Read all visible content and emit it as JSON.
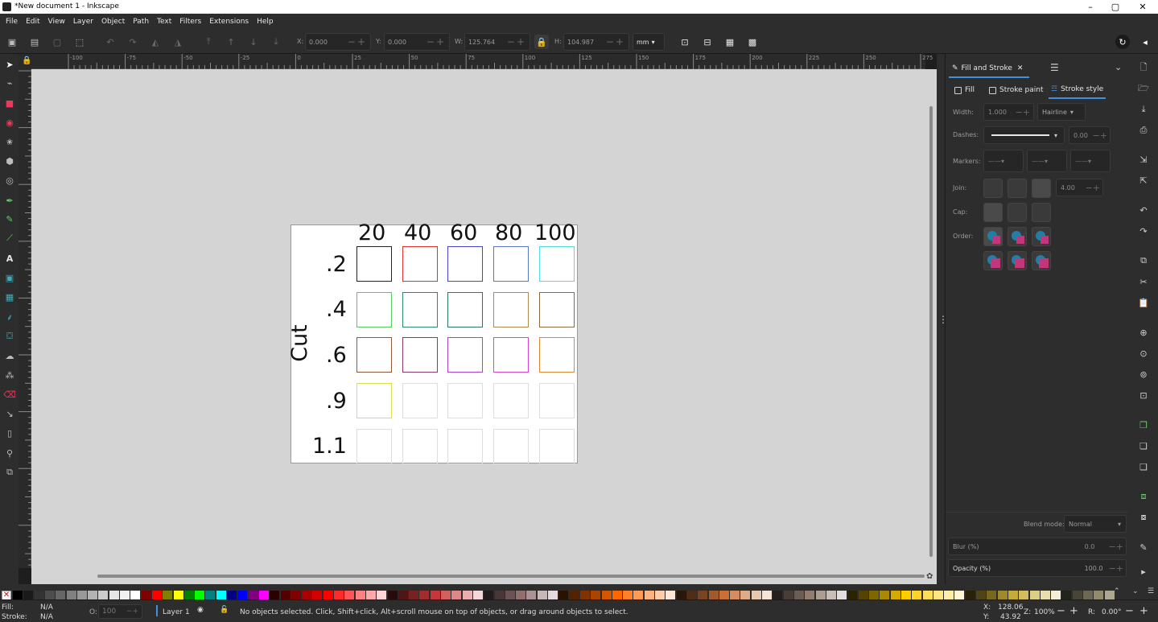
{
  "window": {
    "title": "*New document 1 - Inkscape",
    "minimize": "–",
    "maximize": "▢",
    "close": "✕"
  },
  "menu": [
    "File",
    "Edit",
    "View",
    "Layer",
    "Object",
    "Path",
    "Text",
    "Filters",
    "Extensions",
    "Help"
  ],
  "toolbar": {
    "x_label": "X:",
    "x_value": "0.000",
    "y_label": "Y:",
    "y_value": "0.000",
    "w_label": "W:",
    "w_value": "125.764",
    "h_label": "H:",
    "h_value": "104.987",
    "unit": "mm"
  },
  "ruler": {
    "h_ticks": [
      "-100",
      "-75",
      "-50",
      "-25",
      "0",
      "25",
      "50",
      "75",
      "100",
      "125",
      "150",
      "175",
      "200",
      "225",
      "250",
      "275"
    ]
  },
  "document": {
    "columns": [
      "20",
      "40",
      "60",
      "80",
      "100"
    ],
    "rows": [
      ".2",
      ".4",
      ".6",
      ".9",
      "1.1"
    ],
    "side_label": "Cut",
    "square_colors": [
      [
        "#222222",
        "#e03030",
        "#4444cc",
        "#5577cc",
        "#55dddd"
      ],
      [
        "#55cc55",
        "#2a8a6a",
        "#2a7a5a",
        "#b08850",
        "#8a6a40"
      ],
      [
        "#8a5a3a",
        "#8a3a6a",
        "#aa44cc",
        "#dd44cc",
        "#dd8833"
      ],
      [
        "#dddd55",
        "#dddddd",
        "#dddddd",
        "#dddddd",
        "#dddddd"
      ],
      [
        "#dddddd",
        "#dddddd",
        "#dddddd",
        "#dddddd",
        "#dddddd"
      ]
    ]
  },
  "panel": {
    "tab_title": "Fill and Stroke",
    "subtabs": {
      "fill": "Fill",
      "stroke_paint": "Stroke paint",
      "stroke_style": "Stroke style"
    },
    "width_label": "Width:",
    "width_value": "1.000",
    "width_unit": "Hairline",
    "dashes_label": "Dashes:",
    "dash_offset": "0.00",
    "markers_label": "Markers:",
    "join_label": "Join:",
    "miter_limit": "4.00",
    "cap_label": "Cap:",
    "order_label": "Order:",
    "blend_label": "Blend mode:",
    "blend_value": "Normal",
    "blur_label": "Blur (%)",
    "blur_value": "0.0",
    "opacity_label": "Opacity (%)",
    "opacity_value": "100.0"
  },
  "palette": [
    "#000000",
    "#1a1a1a",
    "#333333",
    "#4d4d4d",
    "#666666",
    "#808080",
    "#999999",
    "#b3b3b3",
    "#cccccc",
    "#e6e6e6",
    "#f2f2f2",
    "#ffffff",
    "#800000",
    "#ff0000",
    "#808000",
    "#ffff00",
    "#008000",
    "#00ff00",
    "#008080",
    "#00ffff",
    "#000080",
    "#0000ff",
    "#800080",
    "#ff00ff",
    "#2b0000",
    "#550000",
    "#800000",
    "#aa0000",
    "#d40000",
    "#ff0000",
    "#ff2a2a",
    "#ff5555",
    "#ff8080",
    "#ffaaaa",
    "#ffd5d5",
    "#280b0b",
    "#501616",
    "#782121",
    "#a02c2c",
    "#c83737",
    "#d35f5f",
    "#de8787",
    "#e9afaf",
    "#f4d7d7",
    "#241c1c",
    "#483737",
    "#6c5353",
    "#916f6f",
    "#ac9393",
    "#c8b7b7",
    "#e3dbdb",
    "#2b1100",
    "#552200",
    "#803300",
    "#aa4400",
    "#d45500",
    "#ff6600",
    "#ff7f2a",
    "#ff9955",
    "#ffb380",
    "#ffccaa",
    "#ffe6d5",
    "#28170b",
    "#502d16",
    "#784421",
    "#a05a2c",
    "#c87137",
    "#d38d5f",
    "#deaa87",
    "#e9c6af",
    "#f4e3d7",
    "#241f1c",
    "#483e37",
    "#6c5d53",
    "#917c6f",
    "#ac9d93",
    "#c8beb7",
    "#e3dedb",
    "#2b2200",
    "#554400",
    "#806600",
    "#aa8800",
    "#d4aa00",
    "#ffcc00",
    "#ffd42a",
    "#ffdd55",
    "#ffe680",
    "#ffeeaa",
    "#fff6d5",
    "#28220b",
    "#504416",
    "#786721",
    "#a0892c",
    "#c8ab37",
    "#d3bc5f",
    "#decd87",
    "#e9ddaf",
    "#f4eed7",
    "#24221c",
    "#484537",
    "#6c6753",
    "#918a6f",
    "#aca793",
    "#c8c4b7",
    "#e3e2db"
  ],
  "status": {
    "fill_label": "Fill:",
    "fill_value": "N/A",
    "stroke_label": "Stroke:",
    "stroke_value": "N/A",
    "opacity_label": "O:",
    "opacity_value": "100",
    "layer": "Layer 1",
    "message": "No objects selected. Click, Shift+click, Alt+scroll mouse on top of objects, or drag around objects to select.",
    "x_label": "X:",
    "x_value": "128.06",
    "y_label": "Y:",
    "y_value": "43.92",
    "zoom_label": "Z:",
    "zoom_value": "100%",
    "rotate_label": "R:",
    "rotate_value": "0.00°"
  },
  "icons": [
    "select-icon",
    "node-icon",
    "rect-icon",
    "circle-icon",
    "star-icon",
    "box3d-icon",
    "spiral-icon",
    "pen-icon",
    "pencil-icon",
    "calligraphy-icon",
    "text-icon",
    "gradient-icon",
    "mesh-icon",
    "dropper-icon",
    "bucket-icon",
    "tweak-icon",
    "spray-icon",
    "eraser-icon",
    "connector-icon",
    "pages-icon",
    "zoom-icon",
    "measure-icon"
  ]
}
